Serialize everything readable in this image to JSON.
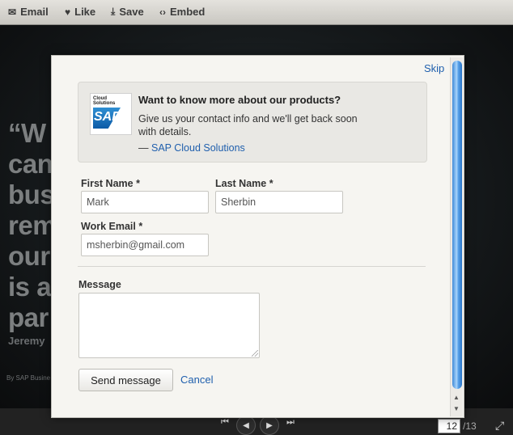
{
  "toolbar": {
    "email": {
      "icon": "envelope-icon",
      "label": "Email"
    },
    "like": {
      "icon": "heart-icon",
      "label": "Like"
    },
    "save": {
      "icon": "download-icon",
      "label": "Save"
    },
    "embed": {
      "icon": "code-icon",
      "label": "Embed"
    }
  },
  "slide": {
    "quote_lines": [
      "“W",
      "can",
      "bus",
      "rem",
      "our",
      "is a",
      "par"
    ],
    "author": "Jeremy",
    "footer": "By SAP Busine"
  },
  "modal": {
    "skip_label": "Skip",
    "promo": {
      "logo_text_line1": "Cloud",
      "logo_text_line2": "Solutions",
      "logo_brand": "SAP",
      "title": "Want to know more about our products?",
      "body": "Give us your contact info and we'll get back soon with details.",
      "signature_prefix": "—",
      "signature_link": "SAP Cloud Solutions"
    },
    "form": {
      "first_name_label": "First Name *",
      "first_name_value": "Mark",
      "last_name_label": "Last Name *",
      "last_name_value": "Sherbin",
      "email_label": "Work Email *",
      "email_value": "msherbin@gmail.com",
      "message_label": "Message",
      "message_value": ""
    },
    "send_label": "Send message",
    "cancel_label": "Cancel"
  },
  "pager": {
    "current_page": "12",
    "total": "/13"
  },
  "colors": {
    "link": "#1f5fad",
    "scroll_thumb": "#5aa3ea",
    "modal_bg": "#f6f5f1"
  }
}
